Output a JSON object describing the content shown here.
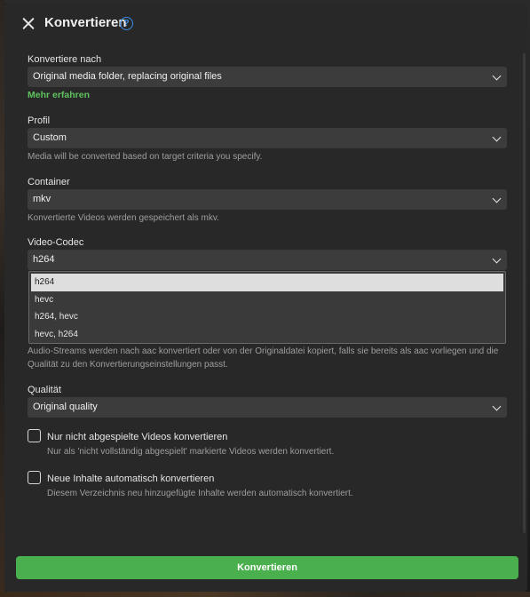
{
  "window": {
    "title": "Konvertieren"
  },
  "target": {
    "label": "Konvertiere nach",
    "value": "Original media folder, replacing original files",
    "learn_more": "Mehr erfahren"
  },
  "profile": {
    "label": "Profil",
    "value": "Custom",
    "help": "Media will be converted based on target criteria you specify."
  },
  "container": {
    "label": "Container",
    "value": "mkv",
    "help": "Konvertierte Videos werden gespeichert als mkv."
  },
  "video_codec": {
    "label": "Video-Codec",
    "value": "h264",
    "options": [
      "h264",
      "hevc",
      "h264, hevc",
      "hevc, h264"
    ],
    "selected_index": 0
  },
  "audio_help": "Audio-Streams werden nach aac konvertiert oder von der Originaldatei kopiert, falls sie bereits als aac vorliegen und die Qualität zu den Konvertierungseinstellungen passt.",
  "quality": {
    "label": "Qualität",
    "value": "Original quality"
  },
  "unwatched": {
    "label": "Nur nicht abgespielte Videos konvertieren",
    "help": "Nur als 'nicht vollständig abgespielt' markierte Videos werden konvertiert.",
    "checked": false
  },
  "auto_new": {
    "label": "Neue Inhalte automatisch konvertieren",
    "help": "Diesem Verzeichnis neu hinzugefügte Inhalte werden automatisch konvertiert.",
    "checked": false
  },
  "submit_label": "Konvertieren",
  "icons": {
    "close": "close-icon",
    "help": "help-icon",
    "chevron": "chevron-down-icon"
  },
  "colors": {
    "accent_green": "#49b04d",
    "link_green": "#5fc35f",
    "help_blue": "#3a8ee6",
    "panel": "#282828",
    "field": "#3c3c3c"
  }
}
